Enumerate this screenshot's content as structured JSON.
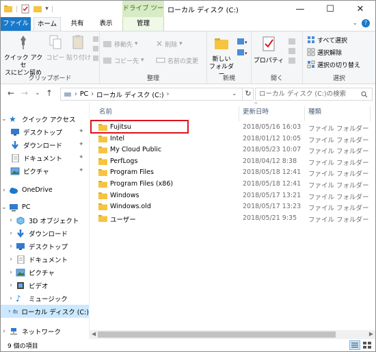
{
  "window": {
    "title": "ローカル ディスク (C:)",
    "context_tab_header": "ドライブ ツール",
    "controls": [
      "—",
      "☐",
      "✕"
    ]
  },
  "tabs": {
    "file": "ファイル",
    "home": "ホーム",
    "share": "共有",
    "view": "表示",
    "manage": "管理"
  },
  "ribbon": {
    "clipboard": {
      "label": "クリップボード",
      "pin_label_1": "クイック アクセ",
      "pin_label_2": "スにピン留め",
      "copy": "コピー",
      "paste": "貼り付け"
    },
    "organize": {
      "label": "整理",
      "move_to": "移動先",
      "copy_to": "コピー先",
      "delete": "削除",
      "rename": "名前の変更"
    },
    "new": {
      "label": "新規",
      "new_folder_1": "新しい",
      "new_folder_2": "フォルダー"
    },
    "open": {
      "label": "開く",
      "properties": "プロパティ"
    },
    "select": {
      "label": "選択",
      "select_all": "すべて選択",
      "select_none": "選択解除",
      "invert": "選択の切り替え"
    }
  },
  "address": {
    "crumbs": [
      "PC",
      "ローカル ディスク (C:)"
    ],
    "search_placeholder": "ローカル ディスク (C:)の検索"
  },
  "columns": {
    "name": "名前",
    "date": "更新日時",
    "type": "種類"
  },
  "files": [
    {
      "name": "Fujitsu",
      "date": "2018/05/16 16:03",
      "type": "ファイル フォルダー"
    },
    {
      "name": "Intel",
      "date": "2018/01/12 10:05",
      "type": "ファイル フォルダー"
    },
    {
      "name": "My Cloud Public",
      "date": "2018/05/23 10:07",
      "type": "ファイル フォルダー"
    },
    {
      "name": "PerfLogs",
      "date": "2018/04/12 8:38",
      "type": "ファイル フォルダー"
    },
    {
      "name": "Program Files",
      "date": "2018/05/18 12:41",
      "type": "ファイル フォルダー"
    },
    {
      "name": "Program Files (x86)",
      "date": "2018/05/18 12:41",
      "type": "ファイル フォルダー"
    },
    {
      "name": "Windows",
      "date": "2018/05/17 13:21",
      "type": "ファイル フォルダー"
    },
    {
      "name": "Windows.old",
      "date": "2018/05/17 13:23",
      "type": "ファイル フォルダー"
    },
    {
      "name": "ユーザー",
      "date": "2018/05/21 9:35",
      "type": "ファイル フォルダー"
    }
  ],
  "nav": {
    "quick_access": "クイック アクセス",
    "qa_items": [
      "デスクトップ",
      "ダウンロード",
      "ドキュメント",
      "ピクチャ"
    ],
    "onedrive": "OneDrive",
    "pc": "PC",
    "pc_items": [
      "3D オブジェクト",
      "ダウンロード",
      "デスクトップ",
      "ドキュメント",
      "ピクチャ",
      "ビデオ",
      "ミュージック",
      "ローカル ディスク (C:)"
    ],
    "network": "ネットワーク"
  },
  "status": {
    "item_count": "9 個の項目"
  },
  "colors": {
    "accent": "#1979ca",
    "folder": "#f6c441",
    "highlight_box": "#d9131a",
    "selection": "#cce8ff"
  }
}
